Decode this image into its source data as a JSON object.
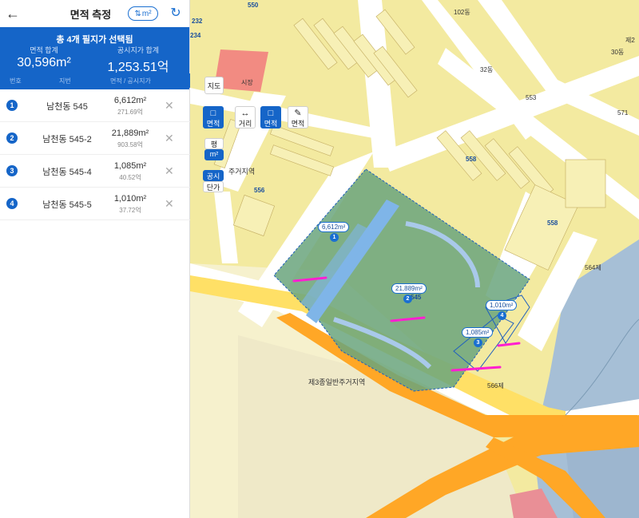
{
  "header": {
    "title": "면적 측정",
    "back_icon": "back-arrow-icon",
    "unit_toggle_label": "m²",
    "refresh_icon": "refresh-icon"
  },
  "summary": {
    "title": "총 4개 필지가 선택됨",
    "area_label": "면적 합계",
    "area_value": "30,596m²",
    "price_label": "공시지가 합계",
    "price_value": "1,253.51억",
    "col_num": "번호",
    "col_lot": "지번",
    "col_area": "면적 / 공시지가"
  },
  "parcels": [
    {
      "num": "1",
      "name": "남천동 545",
      "area": "6,612m²",
      "price": "271.69억"
    },
    {
      "num": "2",
      "name": "남천동 545-2",
      "area": "21,889m²",
      "price": "903.58억"
    },
    {
      "num": "3",
      "name": "남천동 545-4",
      "area": "1,085m²",
      "price": "40.52억"
    },
    {
      "num": "4",
      "name": "남천동 545-5",
      "area": "1,010m²",
      "price": "37.72억"
    }
  ],
  "map": {
    "tools": {
      "map_type": "지도",
      "area_select": "면적",
      "distance": "거리",
      "area_active": "면적",
      "area_draw": "면적",
      "pyeong": "평",
      "sqm": "m²",
      "official": "공시",
      "unit_price": "단가"
    },
    "labels": {
      "market": "시장",
      "zone_residential": "제3종일반주거지역",
      "zone_partial": "주거지역",
      "block_553": "553",
      "block_556": "556",
      "block_558a": "558",
      "block_558b": "558",
      "block_550": "550",
      "block_571": "571",
      "block_102": "102동",
      "block_32": "32동",
      "block_2": "제2",
      "block_30": "30동",
      "lot_566": "566제",
      "lot_564": "564제",
      "lot_232": "232",
      "lot_234": "234",
      "lot_545": "545"
    },
    "bubbles": {
      "b1_area": "6,612m²",
      "b1_num": "1",
      "b2_area": "21,889m²",
      "b2_num": "2",
      "b3_area": "1,085m²",
      "b3_num": "3",
      "b4_area": "1,010m²",
      "b4_num": "4"
    }
  }
}
